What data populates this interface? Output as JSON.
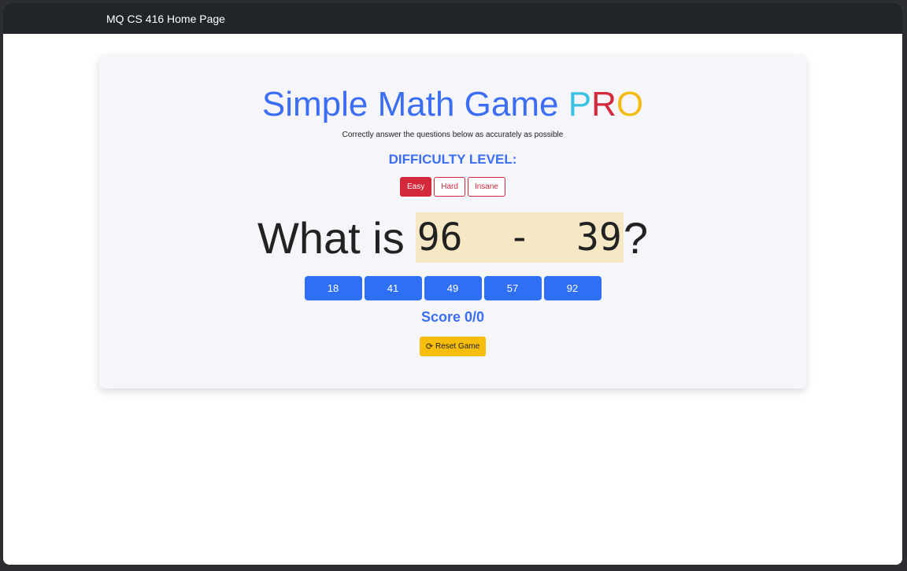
{
  "navbar": {
    "brand": "MQ CS 416 Home Page"
  },
  "game": {
    "title_main": "Simple Math Game ",
    "title_pro": [
      "P",
      "R",
      "O"
    ],
    "subtitle": "Correctly answer the questions below as accurately as possible",
    "difficulty_heading": "DIFFICULTY LEVEL:",
    "difficulty_options": [
      "Easy",
      "Hard",
      "Insane"
    ],
    "difficulty_selected": "Easy",
    "question_prefix": "What is",
    "question_expression": "96 - 39",
    "question_suffix": "?",
    "answers": [
      "18",
      "41",
      "49",
      "57",
      "92"
    ],
    "score_text": "Score 0/0",
    "reset_label": "Reset Game",
    "reset_icon": "refresh-icon"
  },
  "colors": {
    "primary": "#3b6ef5",
    "danger": "#d4283b",
    "info": "#38c3e2",
    "warning": "#f7bd0b",
    "navbar": "#212529",
    "highlight": "#f6e8c4"
  }
}
